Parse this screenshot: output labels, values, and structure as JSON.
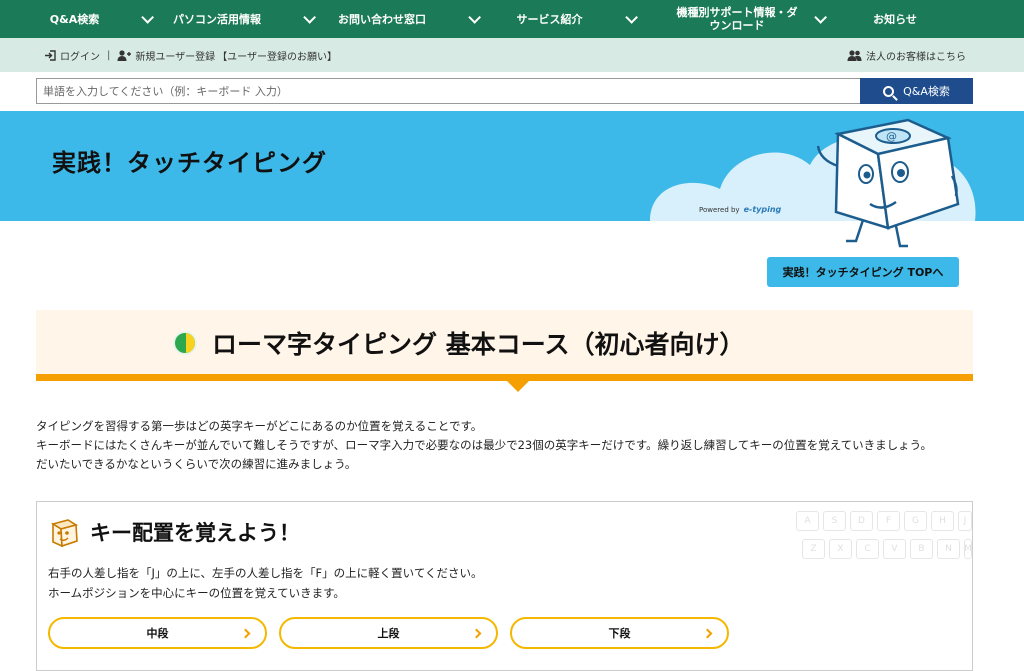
{
  "nav": {
    "items": [
      {
        "label": "Q&A検索"
      },
      {
        "label": "パソコン活用情報"
      },
      {
        "label": "お問い合わせ窓口"
      },
      {
        "label": "サービス紹介"
      },
      {
        "label": "機種別サポート情報・ダウンロード"
      },
      {
        "label": "お知らせ"
      }
    ]
  },
  "userbar": {
    "login": "ログイン",
    "separator": "|",
    "register": "新規ユーザー登録",
    "register_request": "【ユーザー登録のお願い】",
    "corporate": "法人のお客様はこちら"
  },
  "search": {
    "placeholder": "単語を入力してください（例：キーボード 入力）",
    "button": "Q&A検索"
  },
  "hero": {
    "title": "実践！タッチタイピング",
    "powered_prefix": "Powered by",
    "powered_brand": "e-typing"
  },
  "top_button": "実践！タッチタイピング TOPへ",
  "course": {
    "title": "ローマ字タイピング 基本コース（初心者向け）"
  },
  "intro": {
    "line1": "タイピングを習得する第一歩はどの英字キーがどこにあるのか位置を覚えることです。",
    "line2": "キーボードにはたくさんキーが並んでいて難しそうですが、ローマ字入力で必要なのは最少で23個の英字キーだけです。繰り返し練習してキーの位置を覚えていきましょう。",
    "line3": "だいたいできるかなというくらいで次の練習に進みましょう。"
  },
  "card": {
    "title": "キー配置を覚えよう！",
    "text1": "右手の人差し指を「J」の上に、左手の人差し指を「F」の上に軽く置いてください。",
    "text2": "ホームポジションを中心にキーの位置を覚えていきます。",
    "keys_row1": [
      "A",
      "S",
      "D",
      "F",
      "G",
      "H",
      "J"
    ],
    "keys_row2": [
      "Z",
      "X",
      "C",
      "V",
      "B",
      "N",
      "M"
    ],
    "buttons": [
      {
        "label": "中段"
      },
      {
        "label": "上段"
      },
      {
        "label": "下段"
      }
    ]
  },
  "colors": {
    "nav_green": "#1b7a57",
    "hero_blue": "#3cb9e8",
    "accent_orange": "#f5a000",
    "search_button": "#1e4c8c"
  }
}
